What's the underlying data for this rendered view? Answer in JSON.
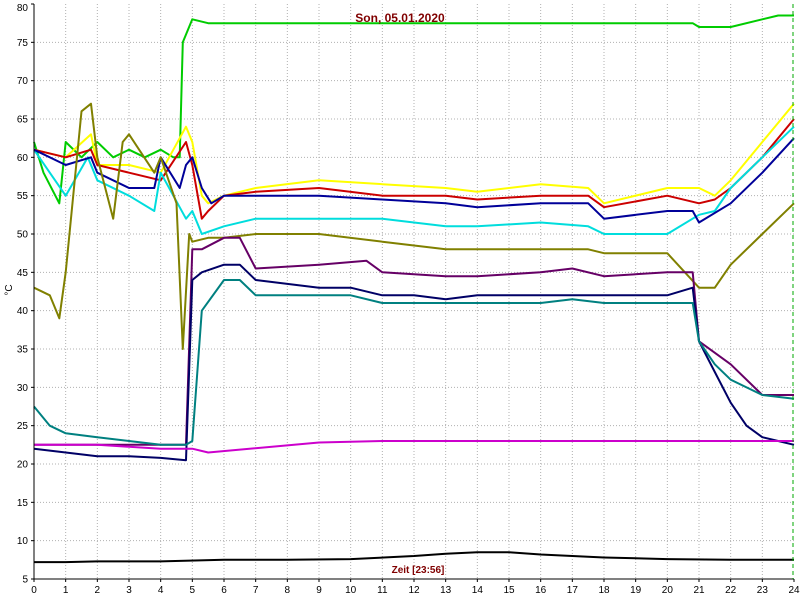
{
  "chart_data": {
    "type": "line",
    "title": "Son, 05.01.2020",
    "xlabel": "Zeit [23:56]",
    "ylabel": "°C",
    "xlim": [
      0,
      24
    ],
    "ylim": [
      5,
      80
    ],
    "xticks": [
      0,
      1,
      2,
      3,
      4,
      5,
      6,
      7,
      8,
      9,
      10,
      11,
      12,
      13,
      14,
      15,
      16,
      17,
      18,
      19,
      20,
      21,
      22,
      23,
      24
    ],
    "yticks": [
      5,
      10,
      15,
      20,
      25,
      30,
      35,
      40,
      45,
      50,
      55,
      60,
      65,
      70,
      75,
      80
    ],
    "grid": true,
    "series": [
      {
        "color": "#00cc00",
        "x": [
          0,
          0.3,
          0.8,
          1,
          1.5,
          2,
          2.5,
          3,
          3.5,
          4,
          4.4,
          4.6,
          4.7,
          5,
          5.5,
          6,
          8,
          10,
          12,
          14,
          16,
          18,
          20,
          20.8,
          21,
          22,
          23,
          23.5,
          24
        ],
        "y": [
          62,
          58,
          54,
          62,
          60,
          62,
          60,
          61,
          60,
          61,
          60,
          60,
          75,
          78,
          77.5,
          77.5,
          77.5,
          77.5,
          77.5,
          77.5,
          77.5,
          77.5,
          77.5,
          77.5,
          77,
          77,
          78,
          78.5,
          78.5
        ]
      },
      {
        "color": "#ffff00",
        "x": [
          0,
          1,
          1.8,
          2,
          3,
          4,
          4.8,
          5,
          5.3,
          5.5,
          6,
          7,
          9,
          11,
          13,
          14,
          16,
          17.5,
          18,
          20,
          21,
          21.5,
          22,
          23,
          24
        ],
        "y": [
          61,
          60,
          63,
          59,
          59,
          58,
          64,
          62,
          55,
          54,
          55,
          56,
          57,
          56.5,
          56,
          55.5,
          56.5,
          56,
          54,
          56,
          56,
          55,
          57,
          62,
          67
        ]
      },
      {
        "color": "#cc0000",
        "x": [
          0,
          1,
          1.8,
          2,
          3,
          4,
          4.8,
          5,
          5.3,
          5.5,
          6,
          7,
          9,
          11,
          13,
          14,
          16,
          17.5,
          18,
          20,
          21,
          21.5,
          22,
          23,
          24
        ],
        "y": [
          61,
          60,
          61,
          59,
          58,
          57,
          62,
          59,
          52,
          53,
          55,
          55.5,
          56,
          55,
          55,
          54.5,
          55,
          55,
          53.5,
          55,
          54,
          54.5,
          56,
          60,
          65
        ]
      },
      {
        "color": "#00dddd",
        "x": [
          0,
          0.5,
          1,
          1.7,
          2,
          3,
          3.8,
          4,
          4.8,
          5,
          5.3,
          6,
          7,
          9,
          11,
          13,
          14,
          16,
          17.5,
          18,
          20,
          21,
          21.5,
          22,
          23,
          24
        ],
        "y": [
          61,
          58,
          55,
          60,
          57,
          55,
          53,
          58,
          52,
          53,
          50,
          51,
          52,
          52,
          52,
          51,
          51,
          51.5,
          51,
          50,
          50,
          52.5,
          53,
          56,
          60,
          64
        ]
      },
      {
        "color": "#000099",
        "x": [
          0,
          1,
          1.8,
          2,
          3,
          3.8,
          4,
          4.6,
          4.8,
          5,
          5.3,
          5.6,
          6,
          7,
          9,
          11,
          13,
          14,
          16,
          17.5,
          18,
          20,
          20.8,
          21,
          22,
          23,
          24
        ],
        "y": [
          61,
          59,
          60,
          58,
          56,
          56,
          60,
          56,
          59,
          60,
          56,
          54,
          55,
          55,
          55,
          54.5,
          54,
          53.5,
          54,
          54,
          52,
          53,
          53,
          51.5,
          54,
          58,
          62.5
        ]
      },
      {
        "color": "#808000",
        "x": [
          0,
          0.5,
          0.8,
          1,
          1.5,
          1.8,
          2,
          2.5,
          2.8,
          3,
          3.8,
          4,
          4.5,
          4.7,
          4.9,
          5,
          5.5,
          6,
          7,
          9,
          11,
          13,
          14,
          16,
          17.5,
          18,
          20,
          21,
          21.5,
          22,
          23,
          24
        ],
        "y": [
          43,
          42,
          39,
          45,
          66,
          67,
          60,
          52,
          62,
          63,
          58,
          60,
          54,
          35,
          50,
          49,
          49.5,
          49.5,
          50,
          50,
          49,
          48,
          48,
          48,
          48,
          47.5,
          47.5,
          43,
          43,
          46,
          50,
          54
        ]
      },
      {
        "color": "#660066",
        "x": [
          0,
          4,
          4.8,
          5,
          5.3,
          6,
          6.5,
          7,
          9,
          10.5,
          11,
          13,
          14,
          16,
          17,
          18,
          20,
          20.8,
          21,
          22,
          23,
          24
        ],
        "y": [
          22.5,
          22.5,
          22.5,
          48,
          48,
          49.5,
          49.5,
          45.5,
          46,
          46.5,
          45,
          44.5,
          44.5,
          45,
          45.5,
          44.5,
          45,
          45,
          36,
          33,
          29,
          29
        ]
      },
      {
        "color": "#000066",
        "x": [
          0,
          1,
          2,
          3,
          4,
          4.8,
          5,
          5.3,
          6,
          6.5,
          7,
          9,
          10,
          11,
          12,
          13,
          14,
          16,
          17,
          18,
          20,
          20.8,
          21,
          21.5,
          22,
          22.5,
          23,
          23.5,
          24
        ],
        "y": [
          22,
          21.5,
          21,
          21,
          20.8,
          20.5,
          44,
          45,
          46,
          46,
          44,
          43,
          43,
          42,
          42,
          41.5,
          42,
          42,
          42,
          42,
          42,
          43,
          36,
          32,
          28,
          25,
          23.5,
          23,
          22.5
        ]
      },
      {
        "color": "#008080",
        "x": [
          0,
          0.5,
          1,
          2,
          3,
          4,
          4.8,
          5,
          5.3,
          6,
          6.5,
          7,
          9,
          10,
          11,
          13,
          14,
          16,
          17,
          18,
          20,
          20.8,
          21,
          21.5,
          22,
          23,
          24
        ],
        "y": [
          27.5,
          25,
          24,
          23.5,
          23,
          22.5,
          22.5,
          23,
          40,
          44,
          44,
          42,
          42,
          42,
          41,
          41,
          41,
          41,
          41.5,
          41,
          41,
          41,
          36,
          33,
          31,
          29,
          28.5
        ]
      },
      {
        "color": "#cc00cc",
        "x": [
          0,
          2,
          4,
          5,
          5.5,
          9,
          11,
          13,
          16,
          18,
          20,
          21,
          22,
          24
        ],
        "y": [
          22.5,
          22.5,
          22,
          22,
          21.5,
          22.8,
          23,
          23,
          23,
          23,
          23,
          23,
          23,
          23
        ]
      },
      {
        "color": "#000000",
        "x": [
          0,
          1,
          2,
          4,
          6,
          8,
          10,
          12,
          13,
          14,
          15,
          16,
          17,
          18,
          20,
          22,
          24
        ],
        "y": [
          7.2,
          7.2,
          7.3,
          7.3,
          7.5,
          7.5,
          7.6,
          8,
          8.3,
          8.5,
          8.5,
          8.2,
          8,
          7.8,
          7.6,
          7.5,
          7.5
        ]
      }
    ]
  }
}
